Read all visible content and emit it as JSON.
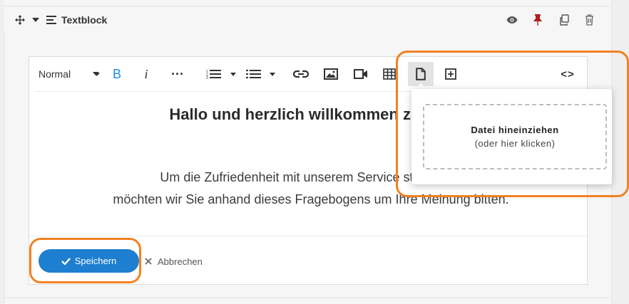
{
  "block": {
    "title": "Textblock",
    "icons": [
      "move-icon",
      "caret-down-icon",
      "text-block-icon",
      "eye-icon",
      "pin-icon",
      "copy-icon",
      "trash-icon"
    ],
    "pin_color": "#b01e1e"
  },
  "toolbar": {
    "format_label": "Normal",
    "bold_label": "B",
    "italic_label": "i",
    "more_label": "···",
    "code_label": "<>",
    "accent_color": "#1e8ce0"
  },
  "content": {
    "heading": "Hallo und herzlich willkommen zu uns",
    "paragraph_line1": "Um die Zufriedenheit mit unserem Service ständig ve",
    "paragraph_line2": "möchten wir Sie anhand dieses Fragebogens um Ihre Meinung bitten."
  },
  "popover": {
    "drop_title": "Datei hineinziehen",
    "drop_subtitle": "(oder hier klicken)"
  },
  "footer": {
    "save_label": "Speichern",
    "cancel_label": "Abbrechen",
    "save_color": "#1e7fd0"
  },
  "highlight_color": "#f28123"
}
